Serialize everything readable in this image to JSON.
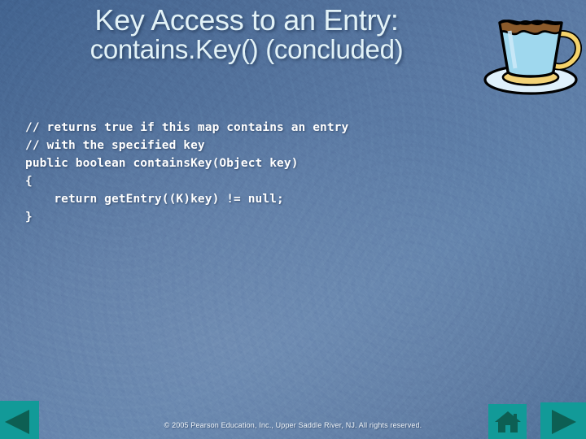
{
  "slide": {
    "title_lines": [
      "Key Access to an Entry:",
      "contains.Key() (concluded)"
    ],
    "code_lines": [
      "// returns true if this map contains an entry",
      "// with the specified key",
      "public boolean containsKey(Object key)",
      "{",
      "    return getEntry((K)key) != null;",
      "}"
    ],
    "footer": "© 2005 Pearson Education, Inc., Upper Saddle River, NJ.  All rights reserved."
  },
  "decor": {
    "coffee_cup_icon": "coffee-cup-icon"
  },
  "nav": {
    "prev_icon": "triangle-left-icon",
    "home_icon": "home-icon",
    "next_icon": "triangle-right-icon"
  },
  "colors": {
    "background_blue": "#5c79a3",
    "background_dark_blue": "#42638f",
    "title_text": "#e2f2f7",
    "code_text": "#ffffff",
    "nav_button": "#129a98",
    "nav_glyph": "#0d5f53",
    "cup_body": "#9fd8ee",
    "cup_accent": "#f5d36b",
    "coffee": "#8a5a2b"
  }
}
